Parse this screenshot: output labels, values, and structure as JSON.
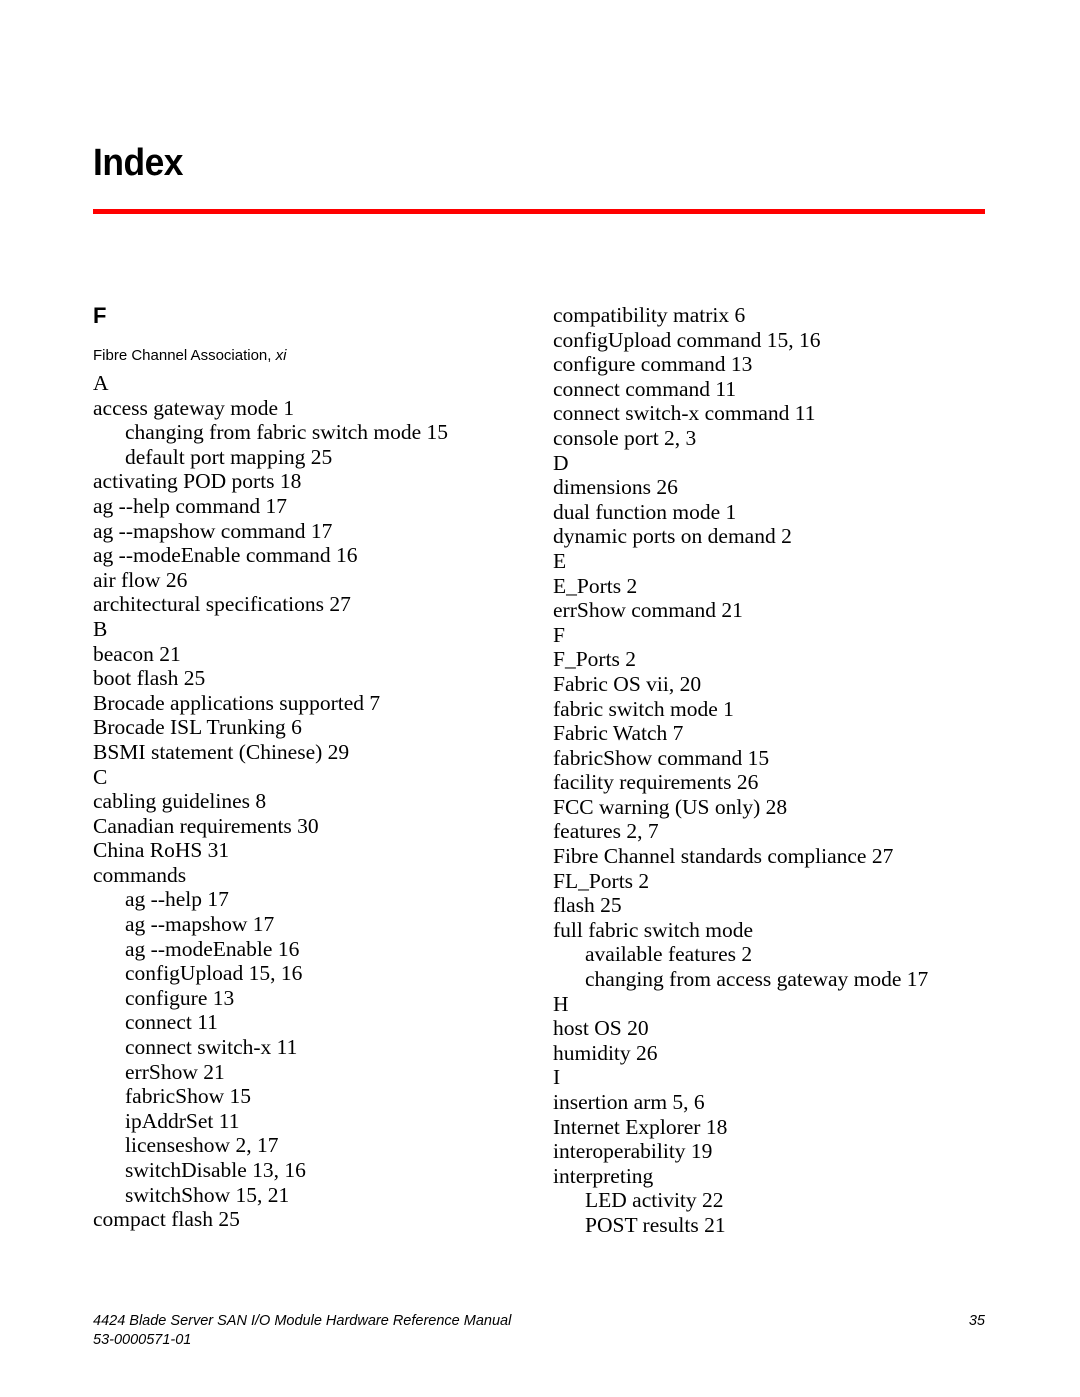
{
  "document": {
    "title": "Index",
    "rule_color": "#ff0000"
  },
  "index": {
    "left_column": [
      {
        "kind": "group-letter",
        "text": "F"
      },
      {
        "kind": "sans-entry",
        "text": "Fibre Channel Association, ",
        "italic_tail": "xi"
      },
      {
        "kind": "section",
        "text": "A"
      },
      {
        "kind": "entry",
        "level": 0,
        "text": "access gateway mode 1"
      },
      {
        "kind": "entry",
        "level": 1,
        "text": "changing from fabric switch mode 15"
      },
      {
        "kind": "entry",
        "level": 1,
        "text": "default port mapping 25"
      },
      {
        "kind": "entry",
        "level": 0,
        "text": "activating POD ports 18"
      },
      {
        "kind": "entry",
        "level": 0,
        "text": "ag --help command 17"
      },
      {
        "kind": "entry",
        "level": 0,
        "text": "ag --mapshow command 17"
      },
      {
        "kind": "entry",
        "level": 0,
        "text": "ag --modeEnable command 16"
      },
      {
        "kind": "entry",
        "level": 0,
        "text": "air flow 26"
      },
      {
        "kind": "entry",
        "level": 0,
        "text": "architectural specifications 27"
      },
      {
        "kind": "section",
        "text": "B"
      },
      {
        "kind": "entry",
        "level": 0,
        "text": "beacon 21"
      },
      {
        "kind": "entry",
        "level": 0,
        "text": "boot flash 25"
      },
      {
        "kind": "entry",
        "level": 0,
        "text": "Brocade applications supported 7"
      },
      {
        "kind": "entry",
        "level": 0,
        "text": "Brocade ISL Trunking 6"
      },
      {
        "kind": "entry",
        "level": 0,
        "text": "BSMI statement (Chinese) 29"
      },
      {
        "kind": "section",
        "text": "C"
      },
      {
        "kind": "entry",
        "level": 0,
        "text": "cabling guidelines 8"
      },
      {
        "kind": "entry",
        "level": 0,
        "text": "Canadian requirements 30"
      },
      {
        "kind": "entry",
        "level": 0,
        "text": "China RoHS 31"
      },
      {
        "kind": "entry",
        "level": 0,
        "text": "commands"
      },
      {
        "kind": "entry",
        "level": 1,
        "text": "ag --help 17"
      },
      {
        "kind": "entry",
        "level": 1,
        "text": "ag --mapshow 17"
      },
      {
        "kind": "entry",
        "level": 1,
        "text": "ag --modeEnable 16"
      },
      {
        "kind": "entry",
        "level": 1,
        "text": "configUpload 15, 16"
      },
      {
        "kind": "entry",
        "level": 1,
        "text": "configure 13"
      },
      {
        "kind": "entry",
        "level": 1,
        "text": "connect 11"
      },
      {
        "kind": "entry",
        "level": 1,
        "text": "connect switch-x 11"
      },
      {
        "kind": "entry",
        "level": 1,
        "text": "errShow 21"
      },
      {
        "kind": "entry",
        "level": 1,
        "text": "fabricShow 15"
      },
      {
        "kind": "entry",
        "level": 1,
        "text": "ipAddrSet 11"
      },
      {
        "kind": "entry",
        "level": 1,
        "text": "licenseshow 2, 17"
      },
      {
        "kind": "entry",
        "level": 1,
        "text": "switchDisable 13, 16"
      },
      {
        "kind": "entry",
        "level": 1,
        "text": "switchShow 15, 21"
      },
      {
        "kind": "entry",
        "level": 0,
        "text": "compact flash 25"
      }
    ],
    "right_column": [
      {
        "kind": "entry",
        "level": 0,
        "text": "compatibility matrix 6"
      },
      {
        "kind": "entry",
        "level": 0,
        "text": "configUpload command 15, 16"
      },
      {
        "kind": "entry",
        "level": 0,
        "text": "configure command 13"
      },
      {
        "kind": "entry",
        "level": 0,
        "text": "connect command 11"
      },
      {
        "kind": "entry",
        "level": 0,
        "text": "connect switch-x command 11"
      },
      {
        "kind": "entry",
        "level": 0,
        "text": "console port 2, 3"
      },
      {
        "kind": "section",
        "text": "D"
      },
      {
        "kind": "entry",
        "level": 0,
        "text": "dimensions 26"
      },
      {
        "kind": "entry",
        "level": 0,
        "text": "dual function mode 1"
      },
      {
        "kind": "entry",
        "level": 0,
        "text": "dynamic ports on demand 2"
      },
      {
        "kind": "section",
        "text": "E"
      },
      {
        "kind": "entry",
        "level": 0,
        "text": "E_Ports 2"
      },
      {
        "kind": "entry",
        "level": 0,
        "text": "errShow command 21"
      },
      {
        "kind": "section",
        "text": "F"
      },
      {
        "kind": "entry",
        "level": 0,
        "text": "F_Ports 2"
      },
      {
        "kind": "entry",
        "level": 0,
        "text": "Fabric OS vii, 20"
      },
      {
        "kind": "entry",
        "level": 0,
        "text": "fabric switch mode 1"
      },
      {
        "kind": "entry",
        "level": 0,
        "text": "Fabric Watch 7"
      },
      {
        "kind": "entry",
        "level": 0,
        "text": "fabricShow command 15"
      },
      {
        "kind": "entry",
        "level": 0,
        "text": "facility requirements 26"
      },
      {
        "kind": "entry",
        "level": 0,
        "text": "FCC warning (US only) 28"
      },
      {
        "kind": "entry",
        "level": 0,
        "text": "features 2, 7"
      },
      {
        "kind": "entry",
        "level": 0,
        "text": "Fibre Channel standards compliance 27"
      },
      {
        "kind": "entry",
        "level": 0,
        "text": "FL_Ports 2"
      },
      {
        "kind": "entry",
        "level": 0,
        "text": "flash 25"
      },
      {
        "kind": "entry",
        "level": 0,
        "text": "full fabric switch mode"
      },
      {
        "kind": "entry",
        "level": 1,
        "text": "available features 2"
      },
      {
        "kind": "entry",
        "level": 1,
        "text": "changing from access gateway mode 17"
      },
      {
        "kind": "section",
        "text": "H"
      },
      {
        "kind": "entry",
        "level": 0,
        "text": "host OS 20"
      },
      {
        "kind": "entry",
        "level": 0,
        "text": "humidity 26"
      },
      {
        "kind": "section",
        "text": "I"
      },
      {
        "kind": "entry",
        "level": 0,
        "text": "insertion arm 5, 6"
      },
      {
        "kind": "entry",
        "level": 0,
        "text": "Internet Explorer 18"
      },
      {
        "kind": "entry",
        "level": 0,
        "text": "interoperability 19"
      },
      {
        "kind": "entry",
        "level": 0,
        "text": "interpreting"
      },
      {
        "kind": "entry",
        "level": 1,
        "text": "LED activity 22"
      },
      {
        "kind": "entry",
        "level": 1,
        "text": "POST results 21"
      }
    ]
  },
  "footer": {
    "manual_title": "4424 Blade Server SAN I/O Module Hardware Reference Manual",
    "part_number": "53-0000571-01",
    "page_number": "35"
  }
}
